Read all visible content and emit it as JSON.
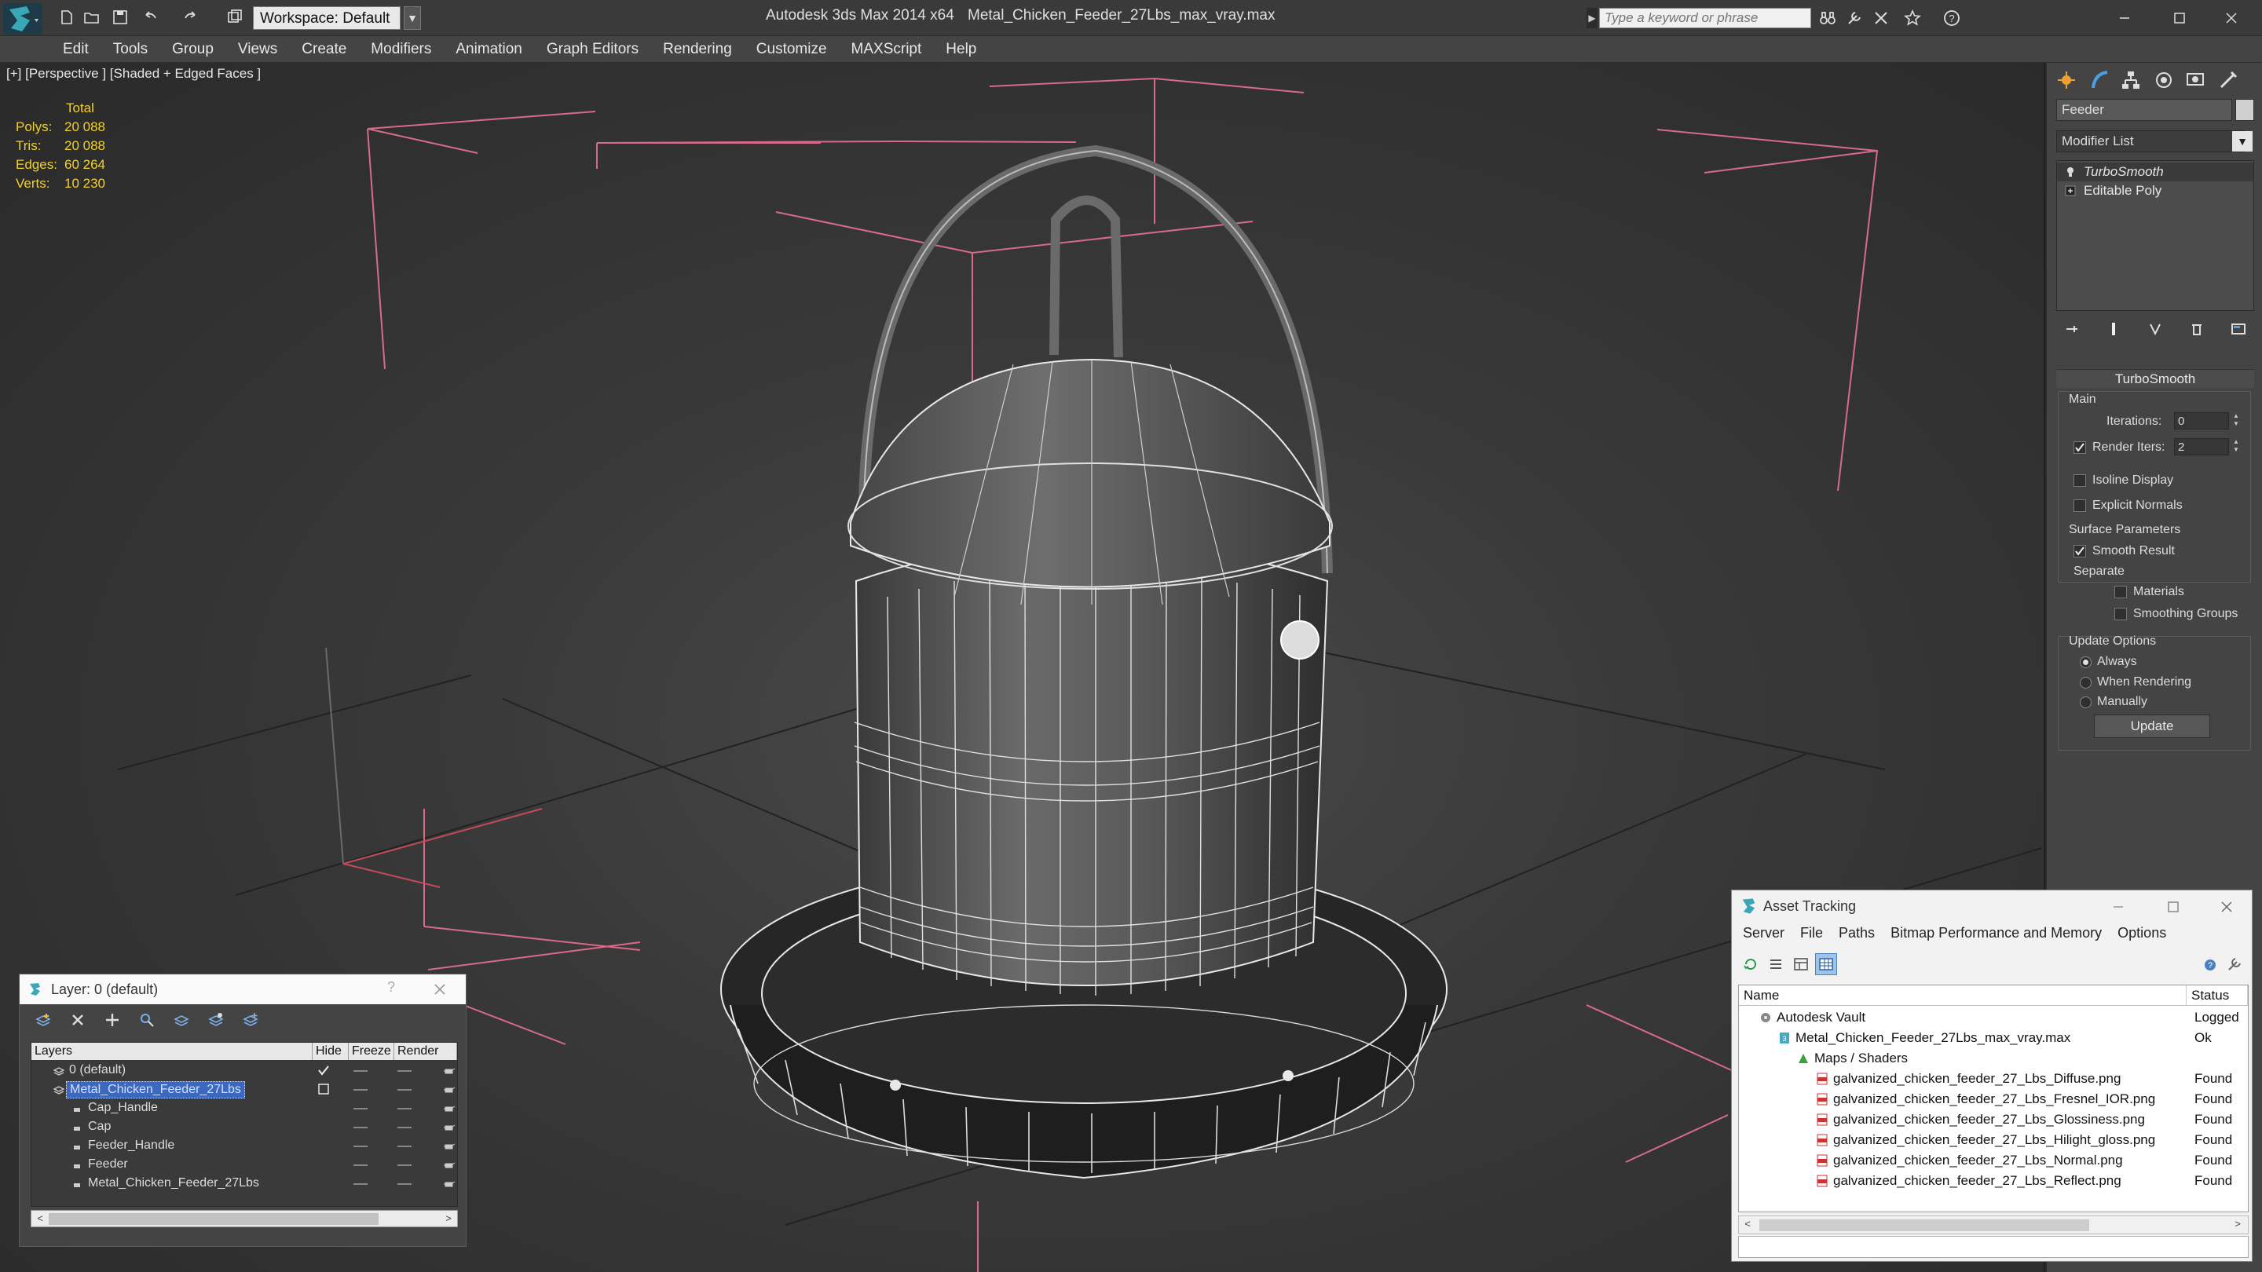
{
  "titlebar": {
    "workspace": "Workspace: Default",
    "app_title": "Autodesk 3ds Max  2014 x64",
    "file_title": "Metal_Chicken_Feeder_27Lbs_max_vray.max",
    "search_placeholder": "Type a keyword or phrase"
  },
  "menubar": [
    "Edit",
    "Tools",
    "Group",
    "Views",
    "Create",
    "Modifiers",
    "Animation",
    "Graph Editors",
    "Rendering",
    "Customize",
    "MAXScript",
    "Help"
  ],
  "viewport": {
    "label": "[+] [Perspective ] [Shaded + Edged Faces ]",
    "stats": {
      "header": "Total",
      "rows": [
        {
          "label": "Polys:",
          "value": "20 088"
        },
        {
          "label": "Tris:",
          "value": "20 088"
        },
        {
          "label": "Edges:",
          "value": "60 264"
        },
        {
          "label": "Verts:",
          "value": "10 230"
        }
      ]
    }
  },
  "command_panel": {
    "object_name": "Feeder",
    "modifier_list": "Modifier List",
    "stack": [
      "TurboSmooth",
      "Editable Poly"
    ],
    "rollout": "TurboSmooth",
    "main_label": "Main",
    "iterations_label": "Iterations:",
    "iterations_value": "0",
    "render_iters_label": "Render Iters:",
    "render_iters_value": "2",
    "isoline_label": "Isoline Display",
    "explicit_label": "Explicit Normals",
    "surface_label": "Surface Parameters",
    "smooth_label": "Smooth Result",
    "separate_label": "Separate",
    "materials_label": "Materials",
    "smoothing_label": "Smoothing Groups",
    "update_opts_label": "Update Options",
    "always_label": "Always",
    "when_label": "When Rendering",
    "manually_label": "Manually",
    "update_btn": "Update"
  },
  "layer_window": {
    "title": "Layer: 0 (default)",
    "help": "?",
    "columns": [
      "Layers",
      "Hide",
      "Freeze",
      "Render"
    ],
    "rows": [
      {
        "name": "0 (default)",
        "indent": 1,
        "kind": "layer"
      },
      {
        "name": "Metal_Chicken_Feeder_27Lbs",
        "indent": 1,
        "kind": "layer",
        "selected": true
      },
      {
        "name": "Cap_Handle",
        "indent": 2,
        "kind": "object"
      },
      {
        "name": "Cap",
        "indent": 2,
        "kind": "object"
      },
      {
        "name": "Feeder_Handle",
        "indent": 2,
        "kind": "object"
      },
      {
        "name": "Feeder",
        "indent": 2,
        "kind": "object"
      },
      {
        "name": "Metal_Chicken_Feeder_27Lbs",
        "indent": 2,
        "kind": "object"
      }
    ]
  },
  "asset_tracking": {
    "title": "Asset Tracking",
    "menu": [
      "Server",
      "File",
      "Paths",
      "Bitmap Performance and Memory",
      "Options"
    ],
    "columns": [
      "Name",
      "Status"
    ],
    "rows": [
      {
        "name": "Autodesk Vault",
        "status": "Logged",
        "indent": 1,
        "icon": "vault-icon"
      },
      {
        "name": "Metal_Chicken_Feeder_27Lbs_max_vray.max",
        "status": "Ok",
        "indent": 2,
        "icon": "max-file-icon"
      },
      {
        "name": "Maps / Shaders",
        "status": "",
        "indent": 3,
        "icon": "maps-folder-icon"
      },
      {
        "name": "galvanized_chicken_feeder_27_Lbs_Diffuse.png",
        "status": "Found",
        "indent": 4,
        "icon": "png-file-icon"
      },
      {
        "name": "galvanized_chicken_feeder_27_Lbs_Fresnel_IOR.png",
        "status": "Found",
        "indent": 4,
        "icon": "png-file-icon"
      },
      {
        "name": "galvanized_chicken_feeder_27_Lbs_Glossiness.png",
        "status": "Found",
        "indent": 4,
        "icon": "png-file-icon"
      },
      {
        "name": "galvanized_chicken_feeder_27_Lbs_Hilight_gloss.png",
        "status": "Found",
        "indent": 4,
        "icon": "png-file-icon"
      },
      {
        "name": "galvanized_chicken_feeder_27_Lbs_Normal.png",
        "status": "Found",
        "indent": 4,
        "icon": "png-file-icon"
      },
      {
        "name": "galvanized_chicken_feeder_27_Lbs_Reflect.png",
        "status": "Found",
        "indent": 4,
        "icon": "png-file-icon"
      }
    ]
  },
  "colors": {
    "accent_yellow": "#f0d030",
    "selection_blue": "#3c68c0",
    "bbox_pink": "#e0708a"
  }
}
